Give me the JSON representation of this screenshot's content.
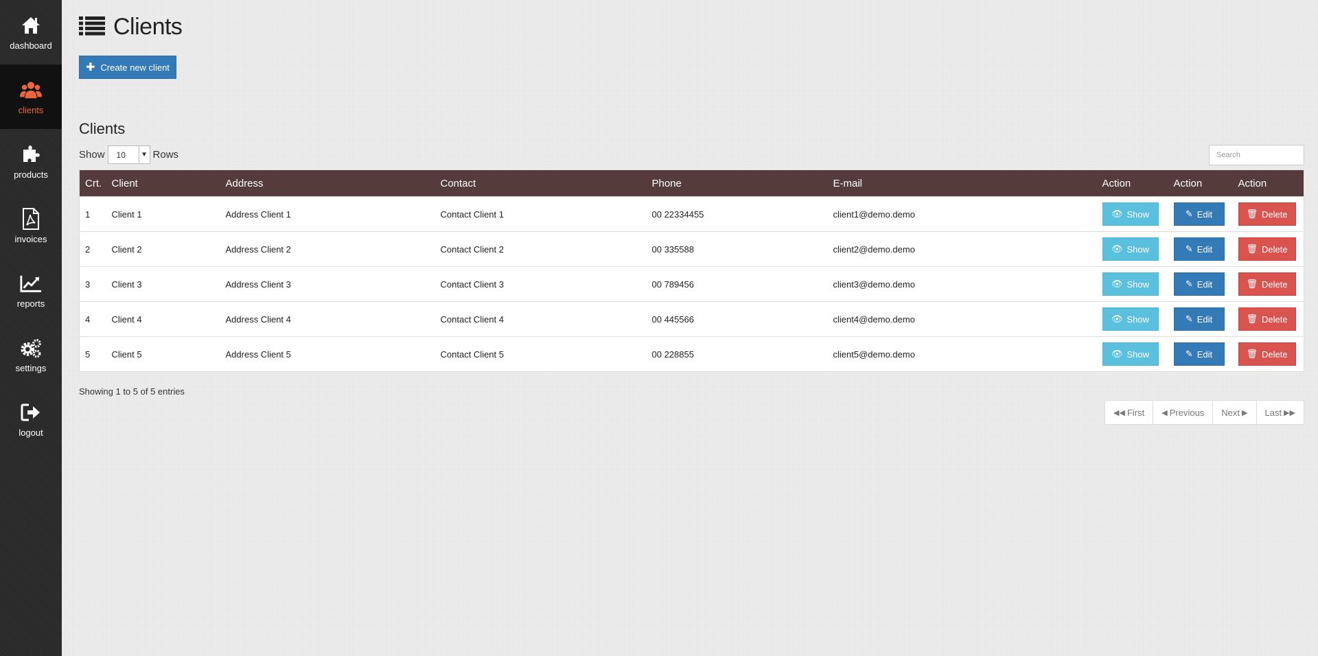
{
  "sidebar": {
    "items": [
      {
        "label": "dashboard",
        "icon": "home-icon"
      },
      {
        "label": "clients",
        "icon": "users-icon",
        "active": true
      },
      {
        "label": "products",
        "icon": "puzzle-icon"
      },
      {
        "label": "invoices",
        "icon": "pdf-file-icon"
      },
      {
        "label": "reports",
        "icon": "line-chart-icon"
      },
      {
        "label": "settings",
        "icon": "gears-icon"
      },
      {
        "label": "logout",
        "icon": "sign-out-icon"
      }
    ],
    "active_color": "#e8663d"
  },
  "header": {
    "title": "Clients",
    "icon": "list-icon"
  },
  "create_button": {
    "label": "Create new client",
    "icon": "plus-icon"
  },
  "section_title": "Clients",
  "length_control": {
    "prefix": "Show",
    "value": "10",
    "suffix": "Rows"
  },
  "search": {
    "placeholder": "Search"
  },
  "table": {
    "header_color": "#553b3b",
    "columns": [
      "Crt.",
      "Client",
      "Address",
      "Contact",
      "Phone",
      "E-mail",
      "Action",
      "Action",
      "Action"
    ],
    "rows": [
      {
        "crt": "1",
        "client": "Client 1",
        "address": "Address Client 1",
        "contact": "Contact Client 1",
        "phone": "00 22334455",
        "email": "client1@demo.demo"
      },
      {
        "crt": "2",
        "client": "Client 2",
        "address": "Address Client 2",
        "contact": "Contact Client 2",
        "phone": "00 335588",
        "email": "client2@demo.demo"
      },
      {
        "crt": "3",
        "client": "Client 3",
        "address": "Address Client 3",
        "contact": "Contact Client 3",
        "phone": "00 789456",
        "email": "client3@demo.demo"
      },
      {
        "crt": "4",
        "client": "Client 4",
        "address": "Address Client 4",
        "contact": "Contact Client 4",
        "phone": "00 445566",
        "email": "client4@demo.demo"
      },
      {
        "crt": "5",
        "client": "Client 5",
        "address": "Address Client 5",
        "contact": "Contact Client 5",
        "phone": "00 228855",
        "email": "client5@demo.demo"
      }
    ],
    "actions": {
      "show": "Show",
      "edit": "Edit",
      "delete": "Delete"
    }
  },
  "info": "Showing 1 to 5 of 5 entries",
  "pagination": {
    "first": "First",
    "previous": "Previous",
    "next": "Next",
    "last": "Last"
  }
}
